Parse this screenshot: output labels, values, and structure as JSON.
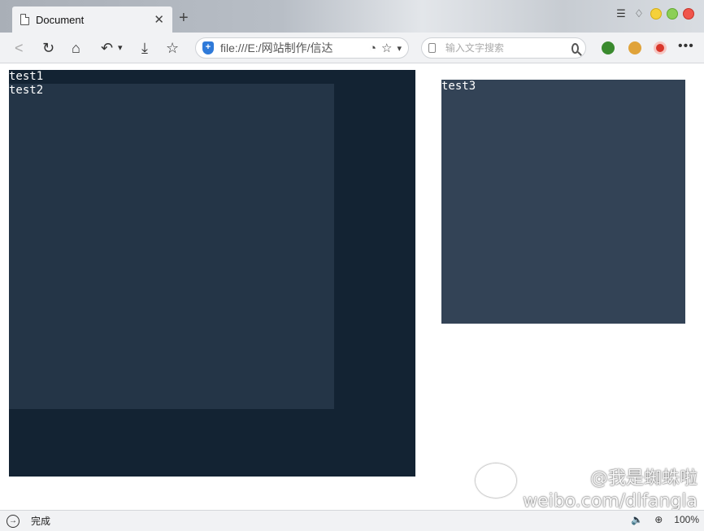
{
  "tab": {
    "title": "Document",
    "close_glyph": "✕",
    "new_tab_glyph": "+"
  },
  "window": {
    "menu_glyph": "☰",
    "skin_glyph": "♢"
  },
  "toolbar": {
    "back_glyph": "<",
    "reload_glyph": "↻",
    "home_glyph": "⌂",
    "undo_glyph": "↶",
    "undo_dropdown_glyph": "▾",
    "download_glyph": "⤓",
    "favorite_glyph": "☆",
    "more_glyph": "•••"
  },
  "address": {
    "security_glyph": "+",
    "url": "file:///E:/网站制作/信达",
    "speed_glyph": "◔",
    "star_glyph": "☆",
    "dropdown_glyph": "▾"
  },
  "search": {
    "placeholder": "输入文字搜索"
  },
  "page": {
    "test1_label": "test1",
    "test2_label": "test2",
    "test3_label": "test3",
    "colors": {
      "test1": "#132333",
      "test2": "#243547",
      "test3": "#334356"
    }
  },
  "watermark": {
    "line1": "@我是蜘蛛啦",
    "line2": "weibo.com/dlfangla"
  },
  "status": {
    "icon_glyph": "→",
    "text": "完成",
    "sound_glyph": "🔈",
    "zoom_glyph": "⊕",
    "zoom_text": "100%"
  }
}
